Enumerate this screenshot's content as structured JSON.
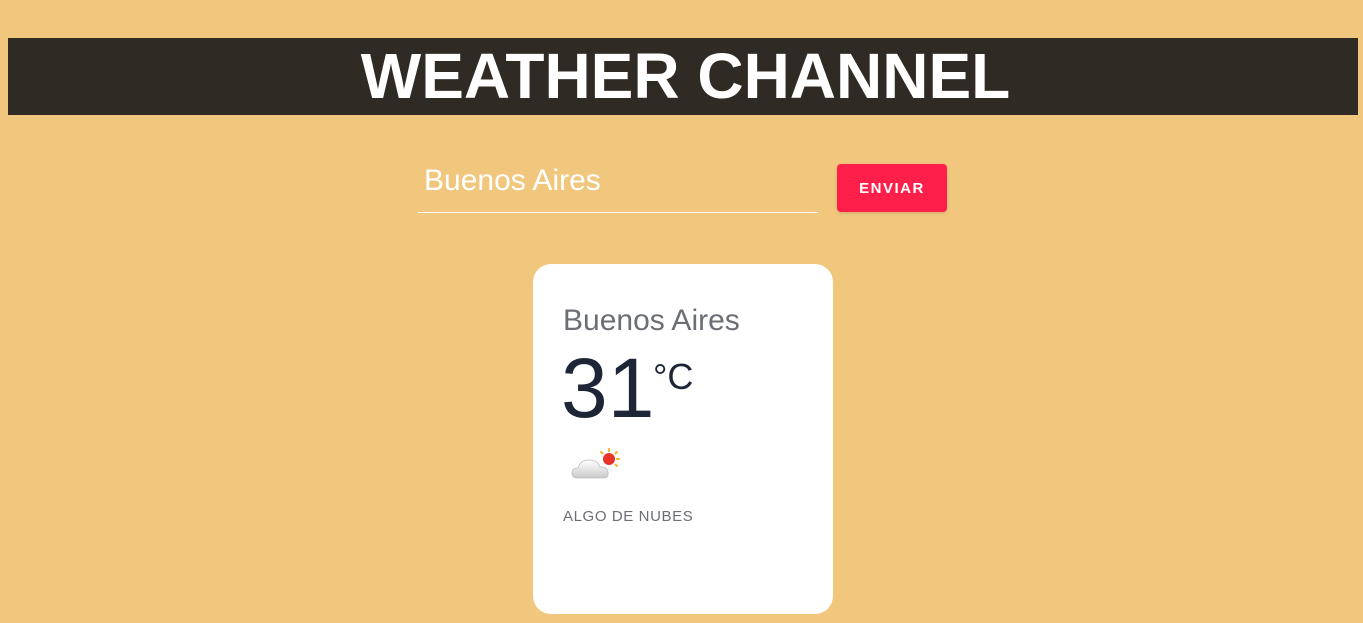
{
  "header": {
    "title": "WEATHER CHANNEL"
  },
  "search": {
    "value": "Buenos Aires",
    "button_label": "ENVIAR"
  },
  "card": {
    "city": "Buenos Aires",
    "temperature": "31",
    "unit": "°C",
    "icon": "partly-cloudy-icon",
    "description": "ALGO DE NUBES"
  }
}
